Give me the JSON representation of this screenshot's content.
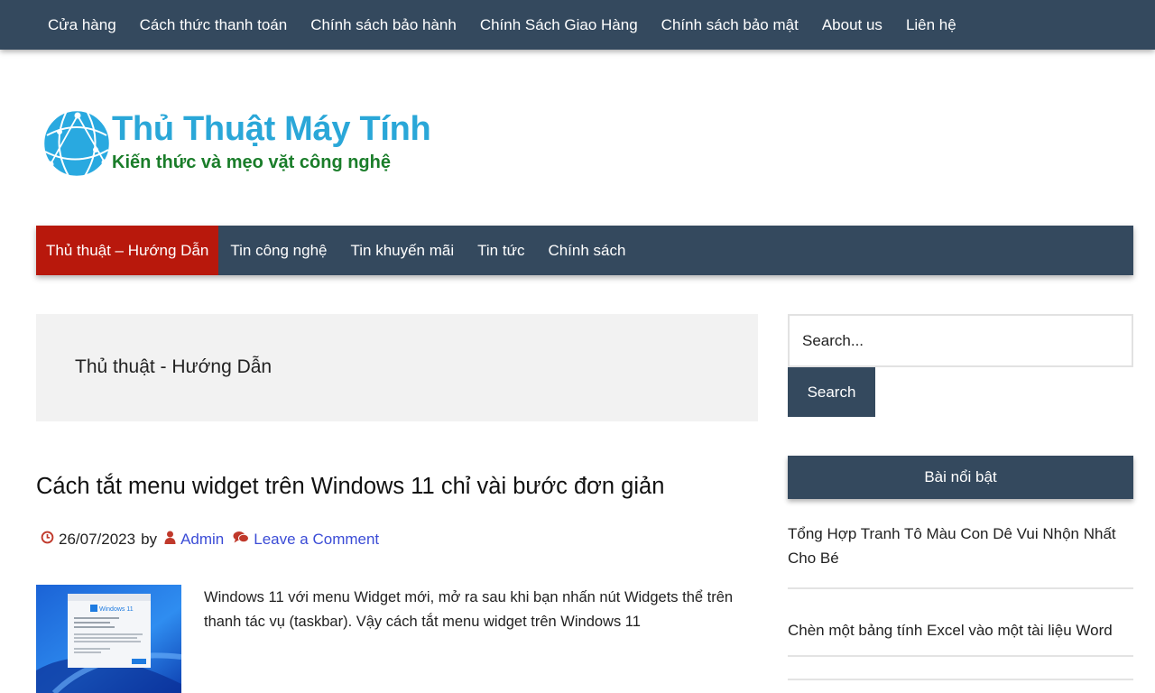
{
  "top_menu": [
    "Cửa hàng",
    "Cách thức thanh toán",
    "Chính sách bảo hành",
    "Chính Sách Giao Hàng",
    "Chính sách bảo mật",
    "About us",
    "Liên hệ"
  ],
  "logo": {
    "title": "Thủ Thuật Máy Tính",
    "tagline": "Kiến thức và mẹo vặt công nghệ"
  },
  "main_menu": [
    "Thủ thuật – Hướng Dẫn",
    "Tin công nghệ",
    "Tin khuyến mãi",
    "Tin tức",
    "Chính sách"
  ],
  "archive": {
    "title": "Thủ thuật - Hướng Dẫn"
  },
  "post": {
    "title": "Cách tắt menu widget trên Windows 11 chỉ vài bước đơn giản",
    "date": "26/07/2023",
    "by": "by",
    "author": "Admin",
    "comment_link": "Leave a Comment",
    "excerpt": "Windows 11 với menu Widget mới, mở ra sau khi bạn nhấn nút Widgets thể trên thanh tác vụ (taskbar). Vậy cách tắt menu widget trên Windows 11",
    "thumb_caption": "Windows 11"
  },
  "sidebar": {
    "search_placeholder": "Search...",
    "search_button": "Search",
    "featured_title": "Bài nổi bật",
    "featured": [
      "Tổng Hợp Tranh Tô Màu Con Dê Vui Nhộn Nhất Cho Bé",
      "Chèn một bảng tính Excel vào một tài liệu Word"
    ]
  },
  "colors": {
    "nav_bg": "#34495e",
    "active_menu": "#b8180c",
    "link": "#3b4cd6",
    "meta_icon": "#c0392b",
    "logo_title": "#2aa7d8",
    "logo_tagline": "#1a7d2a"
  },
  "icons": {
    "date": "clock-icon",
    "author": "user-icon",
    "comments": "comments-icon",
    "logo": "globe-icon"
  }
}
